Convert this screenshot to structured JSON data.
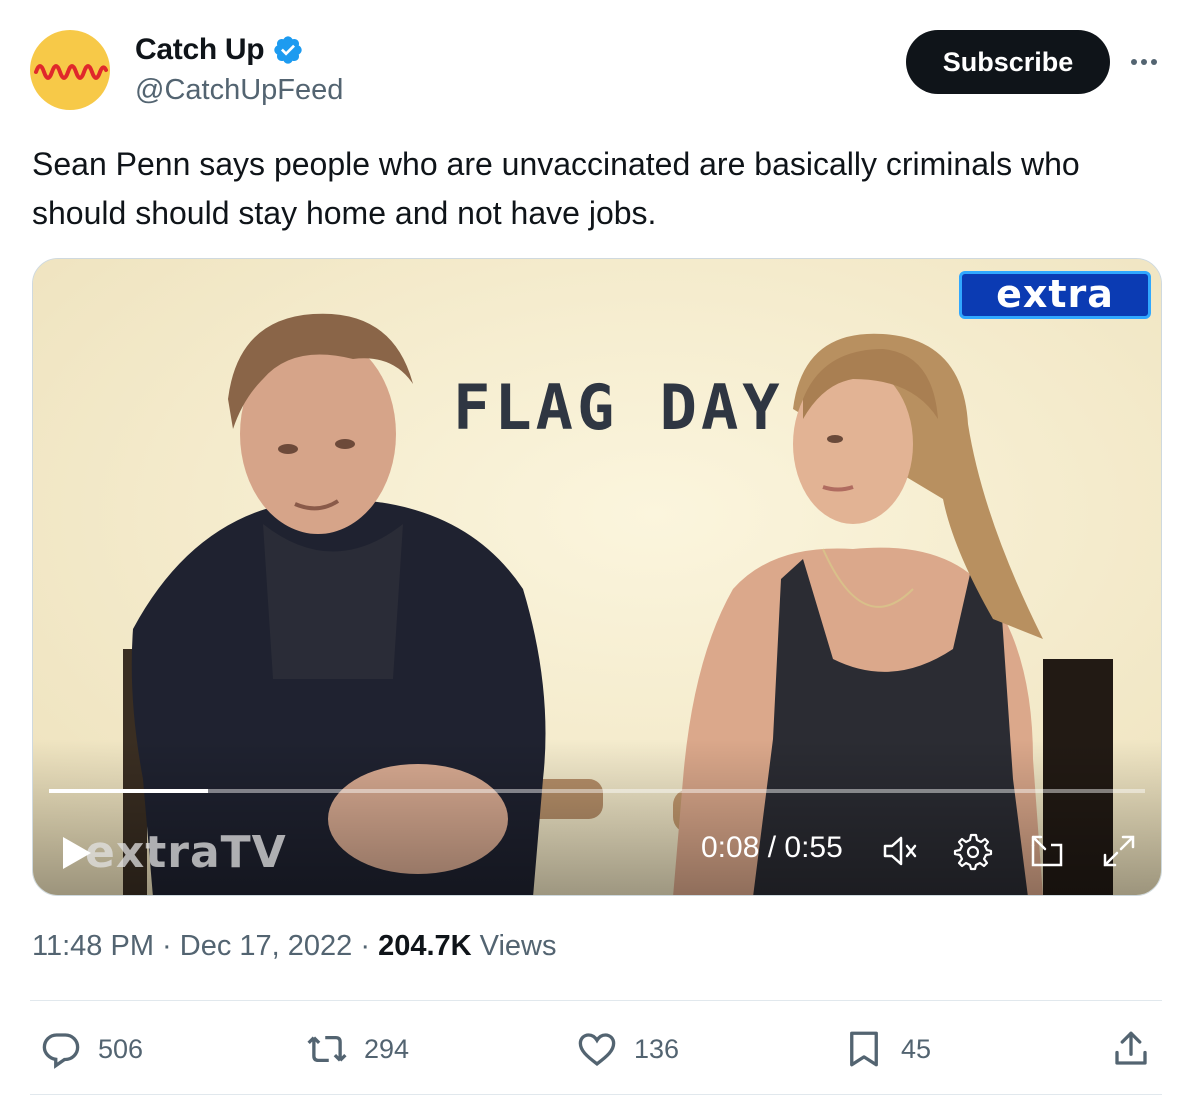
{
  "account": {
    "display_name": "Catch Up",
    "handle": "@CatchUpFeed",
    "avatar_icon": "catchup-wave-logo",
    "verified_icon": "verified-badge-icon",
    "verified_color": "#1d9bf0"
  },
  "subscribe_label": "Subscribe",
  "more_icon": "more-dots-icon",
  "tweet_text": "Sean Penn says people who are unvaccinated are basically criminals who should should stay home and not have jobs.",
  "video": {
    "overlay_logo": "extra",
    "title_card": "FLAG DAY",
    "watermark": "extraTV",
    "time_display": "0:08 / 0:55",
    "progress": 0.145,
    "controls": [
      "play-icon",
      "muted-speaker-icon",
      "settings-gear-icon",
      "picture-in-picture-icon",
      "fullscreen-icon"
    ]
  },
  "meta": {
    "time": "11:48 PM",
    "sep1": " · ",
    "date": "Dec 17, 2022",
    "sep2": " · ",
    "views_count": "204.7K",
    "views_label": " Views"
  },
  "actions": {
    "replies": "506",
    "retweets": "294",
    "likes": "136",
    "bookmarks": "45"
  },
  "colors": {
    "text_primary": "#0f1419",
    "text_secondary": "#536471",
    "button_dark": "#0f1419",
    "avatar_bg": "#f7c948",
    "avatar_wave": "#e0282b"
  }
}
